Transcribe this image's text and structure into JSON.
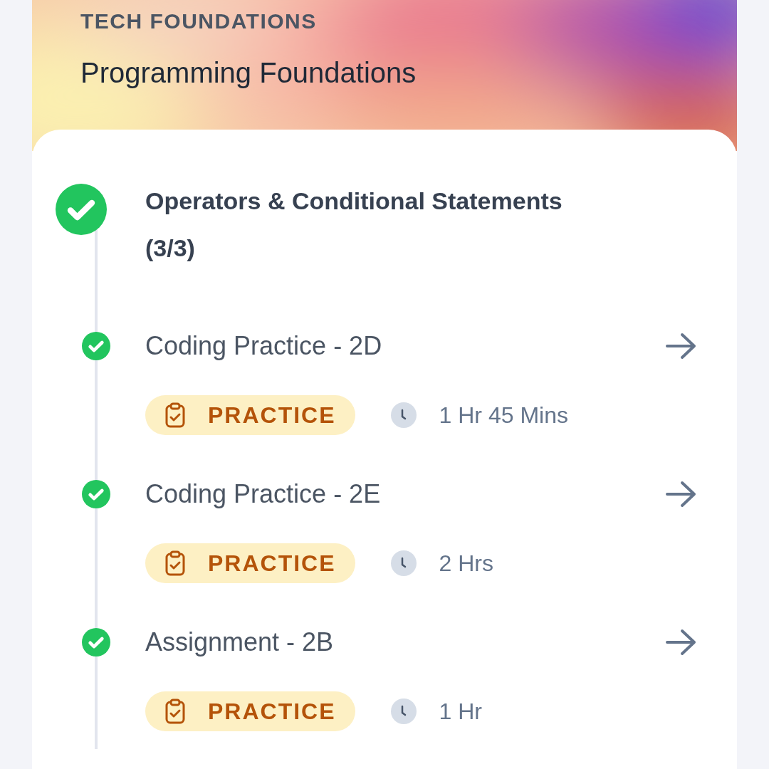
{
  "header": {
    "category": "TECH FOUNDATIONS",
    "course_title": "Programming Foundations"
  },
  "module": {
    "title": "Operators & Conditional Statements",
    "progress": "(3/3)",
    "completed": true,
    "items": [
      {
        "title": "Coding Practice - 2D",
        "completed": true,
        "tag": "PRACTICE",
        "duration": "1 Hr 45 Mins"
      },
      {
        "title": "Coding Practice - 2E",
        "completed": true,
        "tag": "PRACTICE",
        "duration": "2 Hrs"
      },
      {
        "title": "Assignment - 2B",
        "completed": true,
        "tag": "PRACTICE",
        "duration": "1 Hr"
      }
    ]
  }
}
